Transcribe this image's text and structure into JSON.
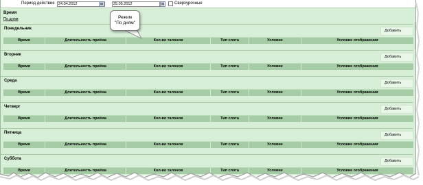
{
  "filter": {
    "period_label": "Период действия",
    "date_from": "24.04.2012",
    "date_to": "25.05.2012",
    "overtime_label": "Сверхурочные"
  },
  "section": {
    "title": "Время",
    "mode_link": "По дням"
  },
  "callout": {
    "line1": "Режим",
    "line2": "\"По дням\""
  },
  "columns": [
    "Время",
    "Длительность приёма",
    "Кол-во талонов",
    "Тип слота",
    "Условие",
    "Условие отображения"
  ],
  "add_label": "Добавить",
  "days": [
    {
      "name": "Понедельник"
    },
    {
      "name": "Вторник"
    },
    {
      "name": "Среда"
    },
    {
      "name": "Четверг"
    },
    {
      "name": "Пятница"
    },
    {
      "name": "Суббота"
    }
  ]
}
